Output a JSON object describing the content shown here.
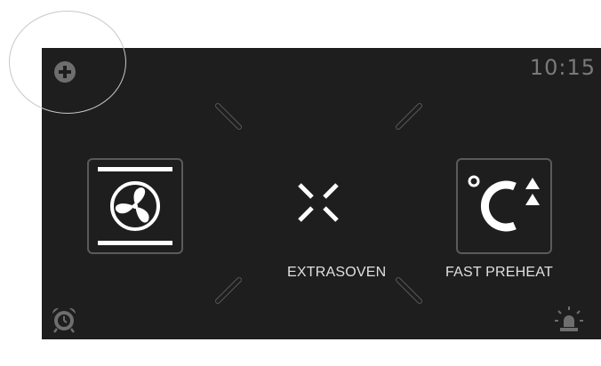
{
  "status": {
    "time": "10:15"
  },
  "functions": [
    {
      "id": "fan",
      "label": "",
      "icon": "fan-icon"
    },
    {
      "id": "extrasoven",
      "label": "EXTRASOVEN",
      "icon": "extrasoven-icon"
    },
    {
      "id": "fast-preheat",
      "label": "FAST PREHEAT",
      "icon": "fast-preheat-icon"
    }
  ],
  "icons": {
    "top_left": "plus-circle-icon",
    "bottom_left": "alarm-clock-icon",
    "bottom_right": "oven-light-icon"
  },
  "colors": {
    "screen_background": "#1e1e1e",
    "icon_white": "#ffffff",
    "icon_grey": "#6e6e6e",
    "clock_text": "#7a7a7a"
  }
}
